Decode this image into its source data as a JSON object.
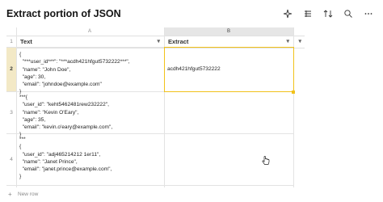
{
  "title": "Extract portion of JSON",
  "toolbar": {
    "icons": [
      "sparkle-icon",
      "columns-icon",
      "sort-icon",
      "search-icon",
      "more-icon"
    ]
  },
  "columns": {
    "letters": [
      "A",
      "B"
    ],
    "headers": [
      "Text",
      "Extract"
    ]
  },
  "rows": [
    {
      "num": "1",
      "text": "",
      "extract": ""
    },
    {
      "num": "2",
      "text": "{\n  \"***user_id***\": \"***acdh421hfgut5732222***\",\n  \"name\": \"John Doe\",\n  \"age\": 30,\n  \"email\": \"johndoe@example.com\"\n}",
      "extract": "acdh421hfgut5732222"
    },
    {
      "num": "3",
      "text": "***{\n  \"user_id\": \"keht5462481rew232222\",\n  \"name\": \"Kevin O'Eary\",\n  \"age\": 35,\n  \"email\": \"kevin.o'eary@example.com\",\n}",
      "extract": ""
    },
    {
      "num": "4",
      "text": "***\n{\n  \"user_id\": \"adj465214212 1er11\",\n  \"name\": \"Janet Prince\",\n  \"email\": \"janet.prince@example.com\",\n}",
      "extract": ""
    }
  ],
  "new_row_label": "New row"
}
